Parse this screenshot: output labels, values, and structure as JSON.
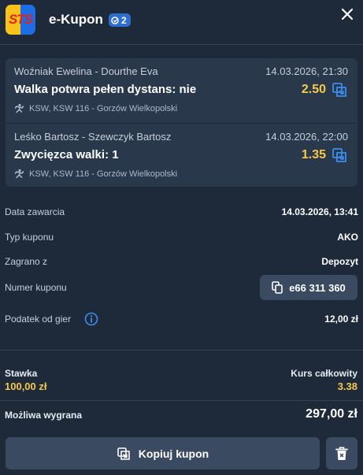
{
  "header": {
    "logo_text": "STS",
    "title": "e-Kupon",
    "badge_count": "2"
  },
  "bets": [
    {
      "teams": "Woźniak Ewelina - Dourthe Eva",
      "date": "14.03.2026, 21:30",
      "pick": "Walka potwra pełen dystans: nie",
      "odd": "2.50",
      "league": "KSW, KSW 116 - Gorzów Wielkopolski"
    },
    {
      "teams": "Leśko Bartosz - Szewczyk Bartosz",
      "date": "14.03.2026, 22:00",
      "pick": "Zwycięzca walki: 1",
      "odd": "1.35",
      "league": "KSW, KSW 116 - Gorzów Wielkopolski"
    }
  ],
  "details": {
    "date_label": "Data zawarcia",
    "date_value": "14.03.2026, 13:41",
    "type_label": "Typ kuponu",
    "type_value": "AKO",
    "played_label": "Zagrano z",
    "played_value": "Depozyt",
    "number_label": "Numer kuponu",
    "number_value": "e66 311 360",
    "tax_label": "Podatek od gier",
    "tax_value": "12,00 zł"
  },
  "summary": {
    "stake_label": "Stawka",
    "stake_value": "100,00 zł",
    "rate_label": "Kurs całkowity",
    "rate_value": "3.38",
    "win_label": "Możliwa wygrana",
    "win_value": "297,00 zł"
  },
  "actions": {
    "copy_label": "Kopiuj kupon"
  },
  "colors": {
    "background": "#1e2a3a",
    "card": "#2a384b",
    "accent_yellow": "#f5c84a",
    "badge_blue": "#2d6fd1",
    "button": "#3a4a60"
  }
}
